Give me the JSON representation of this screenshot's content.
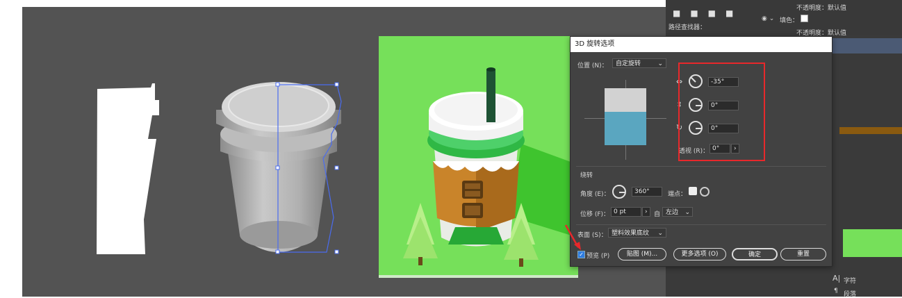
{
  "dialog": {
    "title": "3D 旋转选项",
    "position_label": "位置 (N)：",
    "position_value": "自定旋转",
    "x_angle": "-35°",
    "y_angle": "0°",
    "z_angle": "0°",
    "perspective_label": "透视 (R)：",
    "perspective_value": "0°",
    "rotate_section": "绕转",
    "angle_label": "角度 (E)：",
    "angle_value": "360°",
    "cap_label": "端点：",
    "offset_label": "位移 (F)：",
    "offset_value": "0 pt",
    "from_label": "自",
    "from_value": "左边",
    "surface_label": "表面 (S)：",
    "surface_value": "塑料效果底纹",
    "preview_label": "预览 (P)",
    "map_button": "贴图 (M)...",
    "more_button": "更多选项 (O)",
    "ok_button": "确定",
    "reset_button": "重置"
  },
  "right_panel": {
    "opacity1": "不透明度：默认值",
    "fill_label": "填色：",
    "pathfinder": "路径查找器：",
    "opacity2": "不透明度：默认值",
    "char_label": "字符",
    "para_label": "段落"
  },
  "colors": {
    "canvas": "#535353",
    "green_bg": "#76e05a",
    "cube_top": "#d2d2d2",
    "cube_front": "#5aa6c0",
    "highlight": "#e8282b"
  }
}
